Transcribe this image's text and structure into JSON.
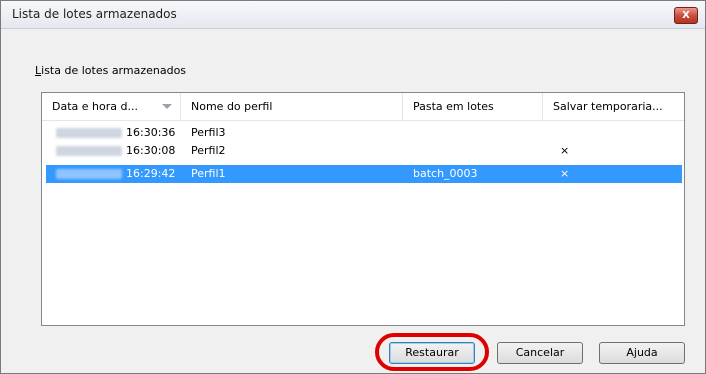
{
  "window": {
    "title": "Lista de lotes armazenados",
    "close_label": "X"
  },
  "group_label": {
    "accel": "L",
    "rest": "ista de lotes armazenados"
  },
  "columns": [
    "Data e hora d...",
    "Nome do perfil",
    "Pasta em lotes",
    "Salvar temporaria..."
  ],
  "rows": [
    {
      "time": "16:30:36",
      "profile": "Perfil3",
      "folder": "",
      "save": "",
      "selected": false
    },
    {
      "time": "16:30:08",
      "profile": "Perfil2",
      "folder": "",
      "save": "×",
      "selected": false
    },
    {
      "time": "16:29:42",
      "profile": "Perfil1",
      "folder": "batch_0003",
      "save": "×",
      "selected": true
    }
  ],
  "buttons": {
    "restore": "Restaurar",
    "cancel": "Cancelar",
    "help": "Ajuda"
  },
  "colors": {
    "selection": "#3399ff",
    "highlight_ring": "#e00000"
  }
}
